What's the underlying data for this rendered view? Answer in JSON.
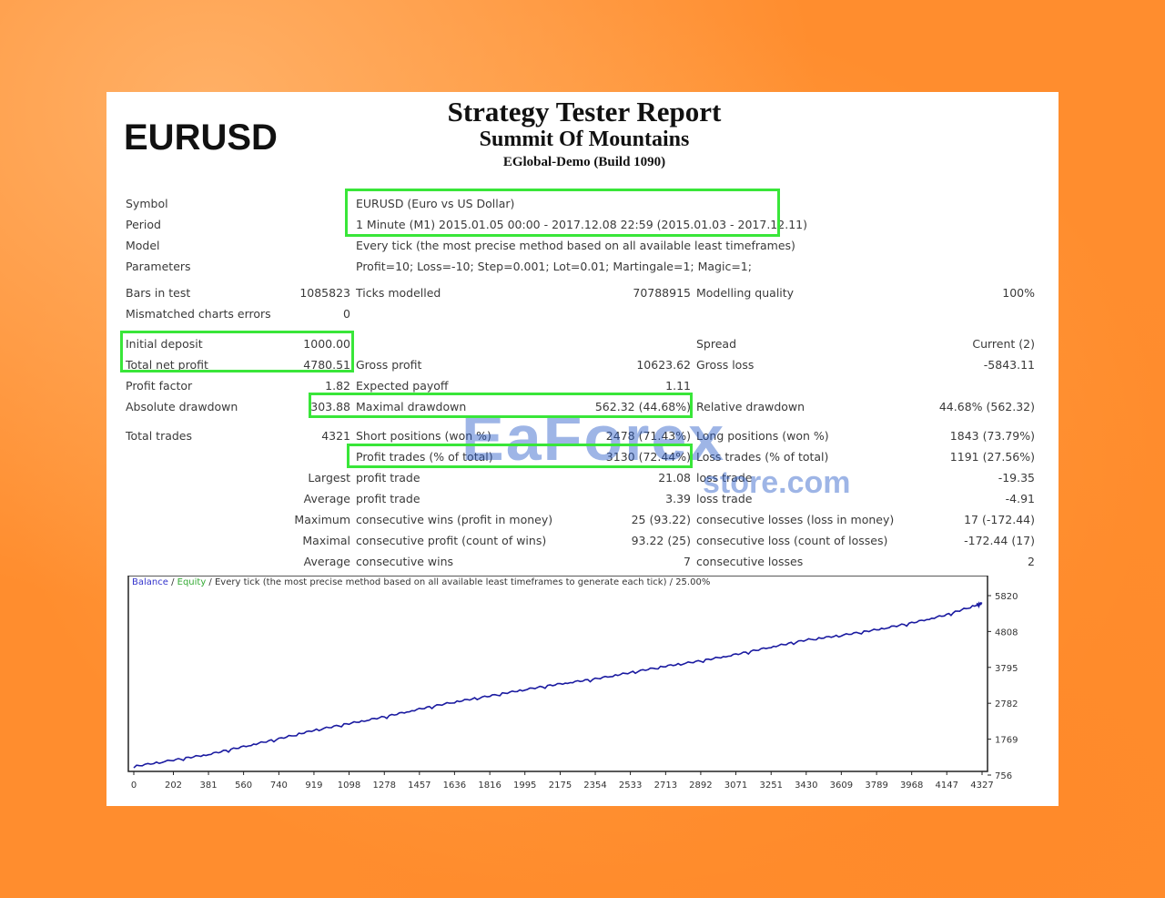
{
  "header": {
    "symbol_big": "EURUSD",
    "title": "Strategy Tester Report",
    "ea_name": "Summit Of Mountains",
    "server": "EGlobal-Demo (Build 1090)"
  },
  "info": {
    "symbol_label": "Symbol",
    "symbol_value": "EURUSD (Euro vs US Dollar)",
    "period_label": "Period",
    "period_value": "1 Minute (M1) 2015.01.05 00:00 - 2017.12.08 22:59 (2015.01.03 - 2017.12.11)",
    "model_label": "Model",
    "model_value": "Every tick (the most precise method based on all available least timeframes)",
    "params_label": "Parameters",
    "params_value": "Profit=10; Loss=-10; Step=0.001; Lot=0.01; Martingale=1; Magic=1;"
  },
  "stats": {
    "bars_label": "Bars in test",
    "bars_value": "1085823",
    "ticks_label": "Ticks modelled",
    "ticks_value": "70788915",
    "quality_label": "Modelling quality",
    "quality_value": "100%",
    "mismatch_label": "Mismatched charts errors",
    "mismatch_value": "0",
    "deposit_label": "Initial deposit",
    "deposit_value": "1000.00",
    "spread_label": "Spread",
    "spread_value": "Current (2)",
    "netprofit_label": "Total net profit",
    "netprofit_value": "4780.51",
    "grossprofit_label": "Gross profit",
    "grossprofit_value": "10623.62",
    "grossloss_label": "Gross loss",
    "grossloss_value": "-5843.11",
    "pf_label": "Profit factor",
    "pf_value": "1.82",
    "payoff_label": "Expected payoff",
    "payoff_value": "1.11",
    "absdd_label": "Absolute drawdown",
    "absdd_value": "303.88",
    "maxdd_label": "Maximal drawdown",
    "maxdd_value": "562.32 (44.68%)",
    "reldd_label": "Relative drawdown",
    "reldd_value": "44.68% (562.32)",
    "trades_label": "Total trades",
    "trades_value": "4321",
    "short_label": "Short positions (won %)",
    "short_value": "2478 (71.43%)",
    "long_label": "Long positions (won %)",
    "long_value": "1843 (73.79%)",
    "profittrades_label": "Profit trades (% of total)",
    "profittrades_value": "3130 (72.44%)",
    "losstrades_label": "Loss trades (% of total)",
    "losstrades_value": "1191 (27.56%)",
    "largest_label": "Largest",
    "largest_profit_label": "profit trade",
    "largest_profit_value": "21.08",
    "largest_loss_label": "loss trade",
    "largest_loss_value": "-19.35",
    "average_label": "Average",
    "average_profit_label": "profit trade",
    "average_profit_value": "3.39",
    "average_loss_label": "loss trade",
    "average_loss_value": "-4.91",
    "maximum_label": "Maximum",
    "max_wins_label": "consecutive wins (profit in money)",
    "max_wins_value": "25 (93.22)",
    "max_losses_label": "consecutive losses (loss in money)",
    "max_losses_value": "17 (-172.44)",
    "maximal_label": "Maximal",
    "maximal_profit_label": "consecutive profit (count of wins)",
    "maximal_profit_value": "93.22 (25)",
    "maximal_loss_label": "consecutive loss (count of losses)",
    "maximal_loss_value": "-172.44 (17)",
    "avg_consec_label": "Average",
    "avg_wins_label": "consecutive wins",
    "avg_wins_value": "7",
    "avg_losses_label": "consecutive losses",
    "avg_losses_value": "2"
  },
  "watermark": {
    "brand": "EaForex",
    "domain": "store.com"
  },
  "legend": {
    "balance": "Balance",
    "sep1": " / ",
    "equity": "Equity",
    "rest": " / Every tick (the most precise method based on all available least timeframes to generate each tick) / 25.00%"
  },
  "colors": {
    "highlight": "#39e639",
    "balance_line": "#1a1aa0",
    "watermark": "#2a5ac8"
  },
  "chart_data": {
    "type": "line",
    "title": "",
    "xlabel": "",
    "ylabel": "",
    "x_ticks": [
      "0",
      "202",
      "381",
      "560",
      "740",
      "919",
      "1098",
      "1278",
      "1457",
      "1636",
      "1816",
      "1995",
      "2175",
      "2354",
      "2533",
      "2713",
      "2892",
      "3071",
      "3251",
      "3430",
      "3609",
      "3789",
      "3968",
      "4147",
      "4327"
    ],
    "y_ticks": [
      "5820",
      "4808",
      "3795",
      "2782",
      "1769",
      "756"
    ],
    "ylim": [
      756,
      5820
    ],
    "xlim": [
      0,
      4327
    ],
    "series": [
      {
        "name": "Balance",
        "x": [
          0,
          202,
          381,
          560,
          740,
          919,
          1098,
          1278,
          1457,
          1636,
          1816,
          1995,
          2175,
          2354,
          2533,
          2713,
          2892,
          3071,
          3251,
          3430,
          3609,
          3789,
          3968,
          4147,
          4300,
          4327
        ],
        "y": [
          1000,
          1180,
          1340,
          1560,
          1780,
          2020,
          2210,
          2400,
          2620,
          2820,
          2990,
          3170,
          3330,
          3470,
          3650,
          3830,
          3980,
          4160,
          4370,
          4570,
          4700,
          4860,
          5050,
          5280,
          5560,
          5600
        ]
      }
    ]
  }
}
